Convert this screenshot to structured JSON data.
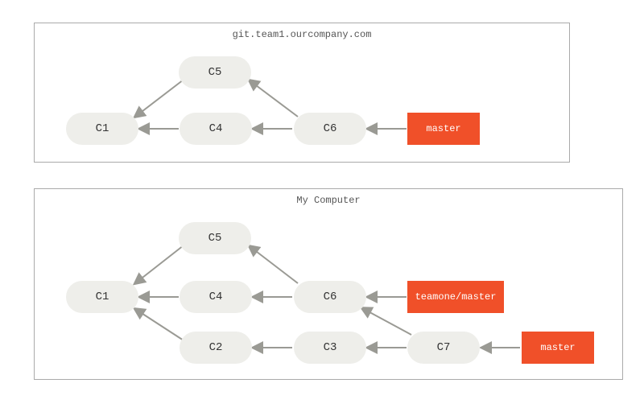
{
  "panels": {
    "server": {
      "title": "git.team1.ourcompany.com"
    },
    "local": {
      "title": "My Computer"
    }
  },
  "server": {
    "c1": "C1",
    "c4": "C4",
    "c5": "C5",
    "c6": "C6",
    "master": "master"
  },
  "local": {
    "c1": "C1",
    "c2": "C2",
    "c3": "C3",
    "c4": "C4",
    "c5": "C5",
    "c6": "C6",
    "c7": "C7",
    "teamone_master": "teamone/master",
    "master": "master"
  },
  "colors": {
    "commit_bg": "#eeeeea",
    "branch_bg": "#f05029",
    "branch_fg": "#ffffff",
    "arrow": "#9a9a94",
    "panel_border": "#aaaaaa"
  }
}
